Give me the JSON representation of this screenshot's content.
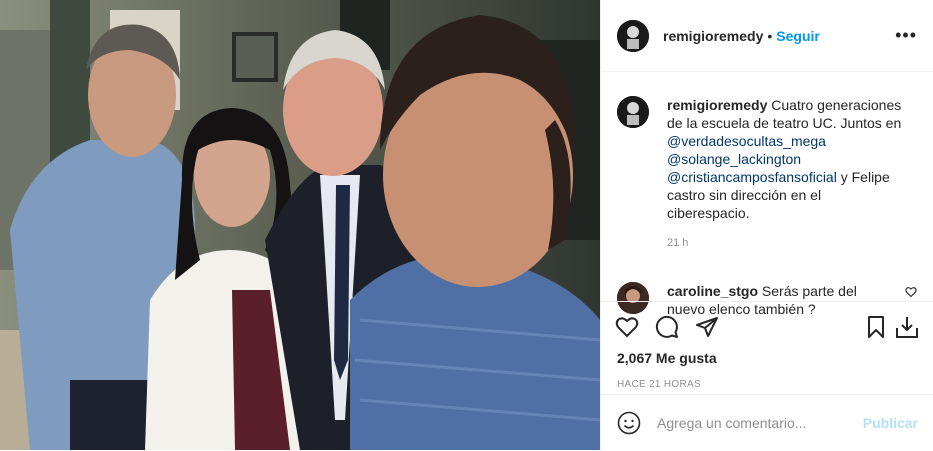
{
  "post": {
    "photo_description": "",
    "author": "remigioremedy",
    "follow_label": "Seguir",
    "separator": "•",
    "more_label": "•••"
  },
  "caption": {
    "username": "remigioremedy",
    "text_1": " Cuatro generaciones de la escuela de teatro UC. Juntos en ",
    "mention_1": "@verdadesocultas_mega",
    "mention_2": "@solange_lackington",
    "mention_3": "@cristiancamposfansoficial",
    "text_2": " y Felipe castro sin dirección en el ciberespacio.",
    "age": "21 h"
  },
  "comment": {
    "username": "caroline_stgo",
    "text": " Serás parte del nuevo elenco también ?"
  },
  "stats": {
    "likes": "2,067 Me gusta",
    "timestamp": "HACE 21 HORAS"
  },
  "composer": {
    "placeholder": "Agrega un comentario...",
    "post_label": "Publicar"
  },
  "icons": {
    "like": "heart-icon",
    "comment": "comment-icon",
    "share": "share-icon",
    "save": "bookmark-icon",
    "download": "download-icon",
    "emoji": "emoji-icon",
    "small_like": "small-heart-icon"
  },
  "colors": {
    "accent": "#0095f6",
    "link": "#00376b",
    "muted": "#8e8e8e",
    "post_disabled": "#b2dffc"
  }
}
